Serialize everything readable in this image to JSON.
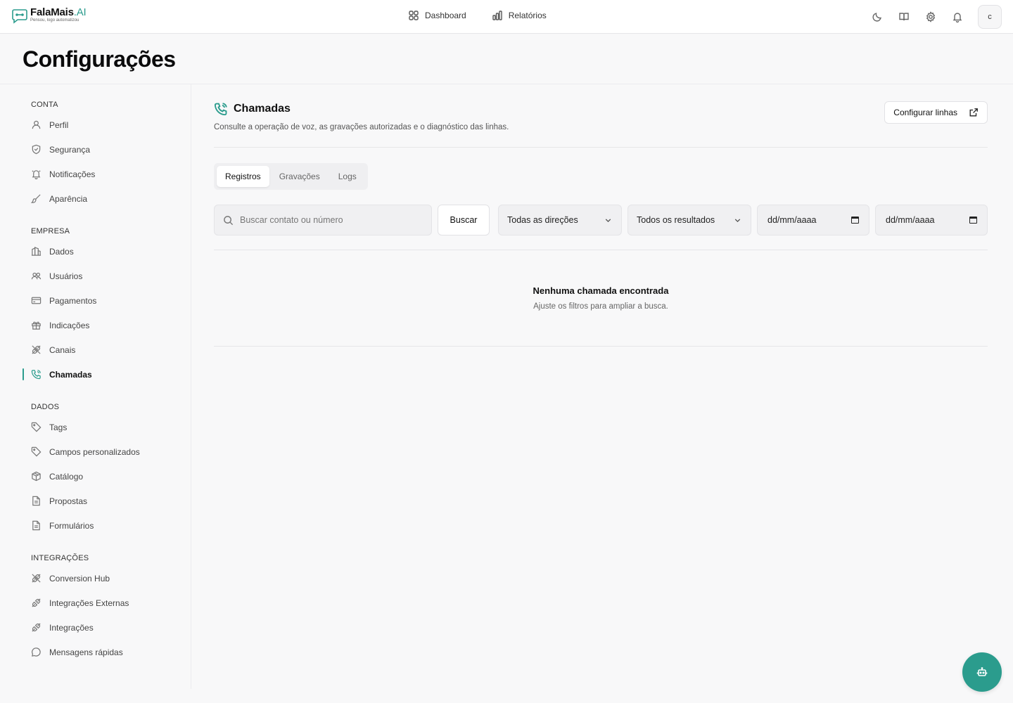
{
  "brand": {
    "name": "FalaMais",
    "suffix": ".AI",
    "tagline": "Pensou, logo automatizou",
    "accent": "#2b9c8d"
  },
  "topnav": [
    {
      "label": "Dashboard",
      "icon": "grid-icon"
    },
    {
      "label": "Relatórios",
      "icon": "bar-chart-icon"
    }
  ],
  "user": {
    "initial": "c"
  },
  "page": {
    "title": "Configurações"
  },
  "sidebar": {
    "sections": [
      {
        "heading": "CONTA",
        "items": [
          {
            "label": "Perfil",
            "icon": "user-icon"
          },
          {
            "label": "Segurança",
            "icon": "shield-icon"
          },
          {
            "label": "Notificações",
            "icon": "bell-icon"
          },
          {
            "label": "Aparência",
            "icon": "brush-icon"
          }
        ]
      },
      {
        "heading": "EMPRESA",
        "items": [
          {
            "label": "Dados",
            "icon": "building-icon"
          },
          {
            "label": "Usuários",
            "icon": "users-icon"
          },
          {
            "label": "Pagamentos",
            "icon": "credit-card-icon"
          },
          {
            "label": "Indicações",
            "icon": "gift-icon"
          },
          {
            "label": "Canais",
            "icon": "plug-icon"
          },
          {
            "label": "Chamadas",
            "icon": "phone-icon",
            "active": true
          }
        ]
      },
      {
        "heading": "DADOS",
        "items": [
          {
            "label": "Tags",
            "icon": "tag-icon"
          },
          {
            "label": "Campos personalizados",
            "icon": "tag-icon"
          },
          {
            "label": "Catálogo",
            "icon": "box-icon"
          },
          {
            "label": "Propostas",
            "icon": "file-icon"
          },
          {
            "label": "Formulários",
            "icon": "file-icon"
          }
        ]
      },
      {
        "heading": "INTEGRAÇÕES",
        "items": [
          {
            "label": "Conversion Hub",
            "icon": "plug-icon"
          },
          {
            "label": "Integrações Externas",
            "icon": "plug-icon"
          },
          {
            "label": "Integrações",
            "icon": "plug-icon"
          },
          {
            "label": "Mensagens rápidas",
            "icon": "chat-icon"
          }
        ]
      }
    ]
  },
  "section": {
    "title": "Chamadas",
    "description": "Consulte a operação de voz, as gravações autorizadas e o diagnóstico das linhas.",
    "configure_label": "Configurar linhas"
  },
  "tabs": [
    {
      "label": "Registros",
      "active": true
    },
    {
      "label": "Gravações"
    },
    {
      "label": "Logs"
    }
  ],
  "filters": {
    "search_placeholder": "Buscar contato ou número",
    "search_button": "Buscar",
    "direction": "Todas as direções",
    "result": "Todos os resultados",
    "date_from": "dd/mm/aaaa",
    "date_to": "dd/mm/aaaa"
  },
  "empty": {
    "title": "Nenhuma chamada encontrada",
    "subtitle": "Ajuste os filtros para ampliar a busca."
  }
}
